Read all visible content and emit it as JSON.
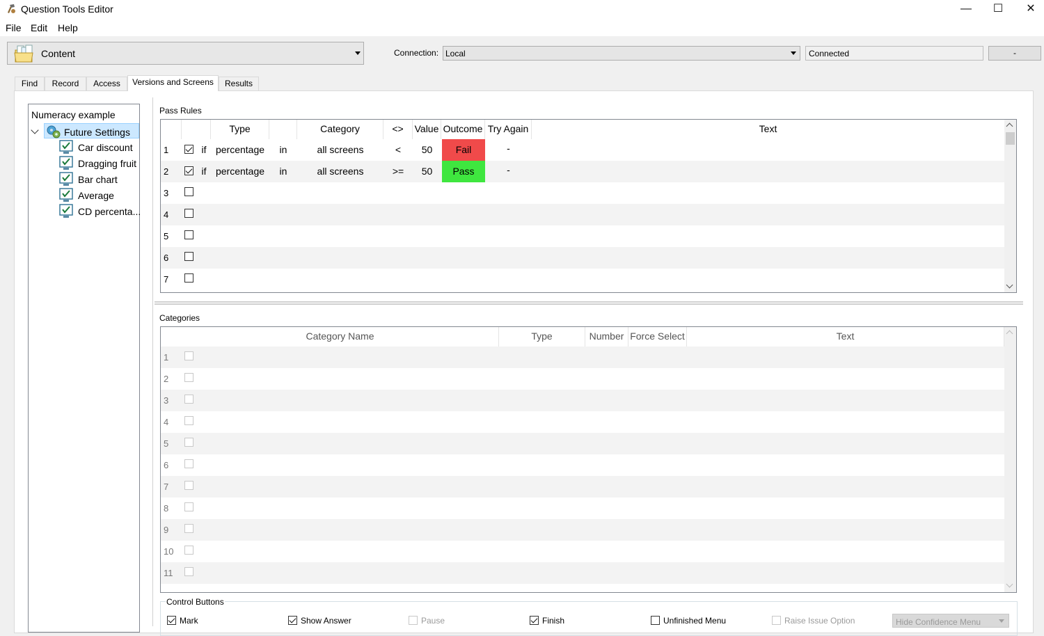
{
  "window": {
    "title": "Question Tools Editor",
    "controls": {
      "minimize": "—",
      "maximize": "☐",
      "close": "✕"
    }
  },
  "menu": [
    "File",
    "Edit",
    "Help"
  ],
  "toolbar": {
    "content_combo": "Content",
    "connection_label": "Connection:",
    "connection_value": "Local",
    "status": "Connected",
    "dash_button": "-"
  },
  "tabs": [
    {
      "label": "Find",
      "active": false
    },
    {
      "label": "Record",
      "active": false
    },
    {
      "label": "Access",
      "active": false
    },
    {
      "label": "Versions and Screens",
      "active": true
    },
    {
      "label": "Results",
      "active": false
    }
  ],
  "tree": {
    "root": "Numeracy example",
    "node": "Future Settings",
    "leaves": [
      "Car discount",
      "Dragging fruit",
      "Bar chart",
      "Average",
      "CD percenta..."
    ]
  },
  "pass_rules": {
    "title": "Pass Rules",
    "headers": [
      "Type",
      "Category",
      "<>",
      "Value",
      "Outcome",
      "Try Again",
      "Text"
    ],
    "rows": [
      {
        "num": "1",
        "checked": true,
        "if": "if",
        "type": "percentage",
        "in": "in",
        "category": "all screens",
        "op": "<",
        "value": "50",
        "outcome": "Fail",
        "outcome_color": "#f04a4a",
        "try_again": "-"
      },
      {
        "num": "2",
        "checked": true,
        "if": "if",
        "type": "percentage",
        "in": "in",
        "category": "all screens",
        "op": ">=",
        "value": "50",
        "outcome": "Pass",
        "outcome_color": "#3fe63f",
        "try_again": "-"
      },
      {
        "num": "3",
        "checked": false
      },
      {
        "num": "4",
        "checked": false
      },
      {
        "num": "5",
        "checked": false
      },
      {
        "num": "6",
        "checked": false
      },
      {
        "num": "7",
        "checked": false
      }
    ]
  },
  "categories": {
    "title": "Categories",
    "headers": [
      "Category Name",
      "Type",
      "Number",
      "Force Select",
      "Text"
    ],
    "rows": [
      "1",
      "2",
      "3",
      "4",
      "5",
      "6",
      "7",
      "8",
      "9",
      "10",
      "11"
    ]
  },
  "control_buttons": {
    "title": "Control Buttons",
    "items": [
      {
        "label": "Mark",
        "checked": true,
        "enabled": true
      },
      {
        "label": "Show Answer",
        "checked": true,
        "enabled": true
      },
      {
        "label": "Pause",
        "checked": false,
        "enabled": false
      },
      {
        "label": "Finish",
        "checked": true,
        "enabled": true
      },
      {
        "label": "Unfinished Menu",
        "checked": false,
        "enabled": true
      },
      {
        "label": "Raise Issue Option",
        "checked": false,
        "enabled": false
      }
    ],
    "hide_menu": "Hide Confidence Menu"
  },
  "icons": {
    "app": "hammer-icon",
    "content": "folder-pages-icon",
    "node": "gears-icon",
    "leaf": "checked-screen-icon"
  }
}
